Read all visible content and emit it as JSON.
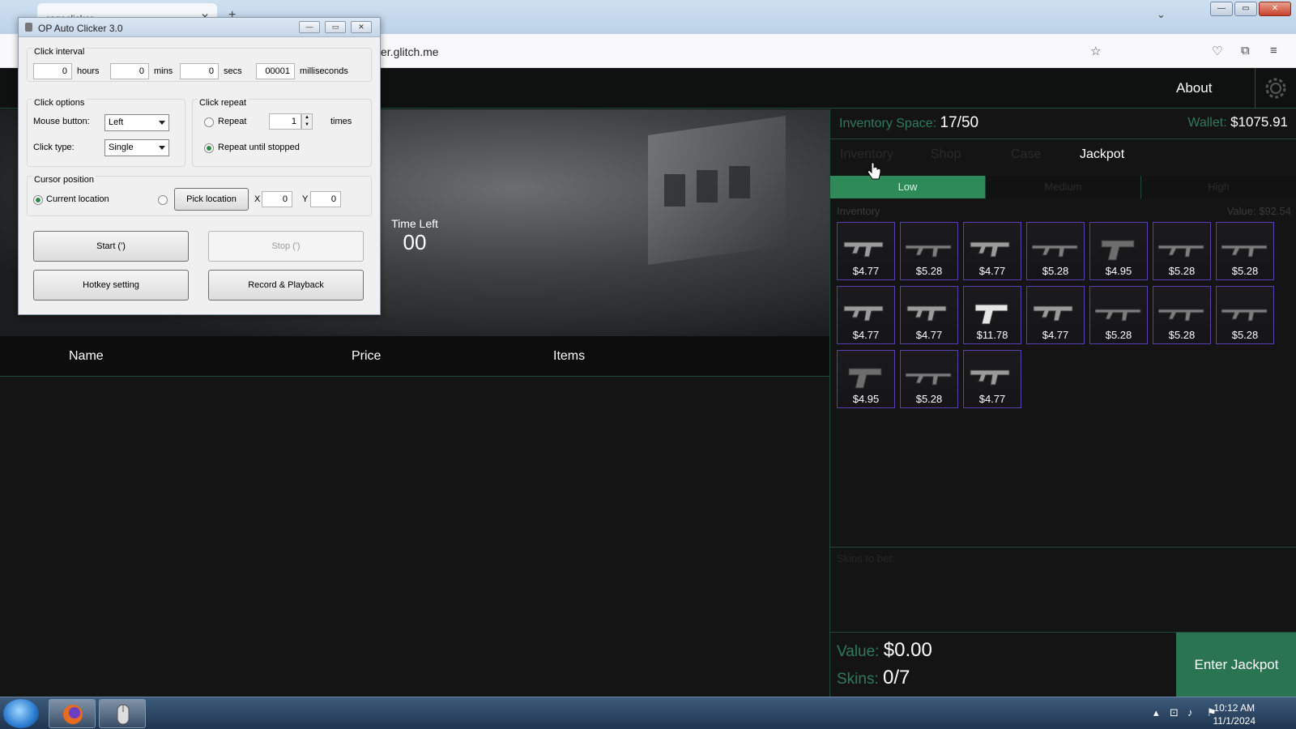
{
  "browser": {
    "tab_title": "csgoclicker",
    "url": "er.glitch.me",
    "tab_close": "✕",
    "new_tab": "+",
    "tabs_list": "⌄"
  },
  "site": {
    "about": "About",
    "inventory_space_label": "Inventory Space:",
    "inventory_space_value": "17/50",
    "wallet_label": "Wallet:",
    "wallet_value": "$1075.91",
    "tabs": [
      "Inventory",
      "Shop",
      "Case",
      "Jackpot"
    ],
    "levels": [
      "Low",
      "Medium",
      "High"
    ],
    "inventory_label": "Inventory",
    "inventory_value": "Value: $92.54",
    "time_left_label": "Time Left",
    "time_left_value": "00",
    "table_headers": [
      "Name",
      "Price",
      "Items"
    ],
    "skins_to_bet": "Skins to bet:",
    "value_label": "Value:",
    "value_amount": "$0.00",
    "skins_label": "Skins:",
    "skins_count": "0/7",
    "enter_button": "Enter Jackpot",
    "items": [
      {
        "price": "$4.77",
        "kind": "smg"
      },
      {
        "price": "$5.28",
        "kind": "rifle"
      },
      {
        "price": "$4.77",
        "kind": "smg"
      },
      {
        "price": "$5.28",
        "kind": "rifle"
      },
      {
        "price": "$4.95",
        "kind": "pistol"
      },
      {
        "price": "$5.28",
        "kind": "rifle"
      },
      {
        "price": "$5.28",
        "kind": "rifle"
      },
      {
        "price": "$4.77",
        "kind": "smg"
      },
      {
        "price": "$4.77",
        "kind": "smg"
      },
      {
        "price": "$11.78",
        "kind": "pistol-white"
      },
      {
        "price": "$4.77",
        "kind": "smg"
      },
      {
        "price": "$5.28",
        "kind": "rifle"
      },
      {
        "price": "$5.28",
        "kind": "rifle"
      },
      {
        "price": "$5.28",
        "kind": "rifle"
      },
      {
        "price": "$4.95",
        "kind": "pistol"
      },
      {
        "price": "$5.28",
        "kind": "rifle"
      },
      {
        "price": "$4.77",
        "kind": "smg"
      }
    ]
  },
  "autoclicker": {
    "title": "OP Auto Clicker 3.0",
    "click_interval": "Click interval",
    "hours_value": "0",
    "hours_label": "hours",
    "mins_value": "0",
    "mins_label": "mins",
    "secs_value": "0",
    "secs_label": "secs",
    "ms_value": "00001",
    "ms_label": "milliseconds",
    "click_options": "Click options",
    "mouse_button_label": "Mouse button:",
    "mouse_button_value": "Left",
    "click_type_label": "Click type:",
    "click_type_value": "Single",
    "click_repeat": "Click repeat",
    "repeat_label": "Repeat",
    "repeat_count": "1",
    "times_label": "times",
    "repeat_until_stopped": "Repeat until stopped",
    "cursor_position": "Cursor position",
    "current_location": "Current location",
    "pick_location": "Pick location",
    "x_label": "X",
    "x_value": "0",
    "y_label": "Y",
    "y_value": "0",
    "start": "Start (')",
    "stop": "Stop (')",
    "hotkey": "Hotkey setting",
    "record": "Record & Playback"
  },
  "taskbar": {
    "time": "10:12 AM",
    "date": "11/1/2024"
  },
  "colors": {
    "accent_green": "#2f8a5a",
    "item_border": "#5a3fb0"
  }
}
